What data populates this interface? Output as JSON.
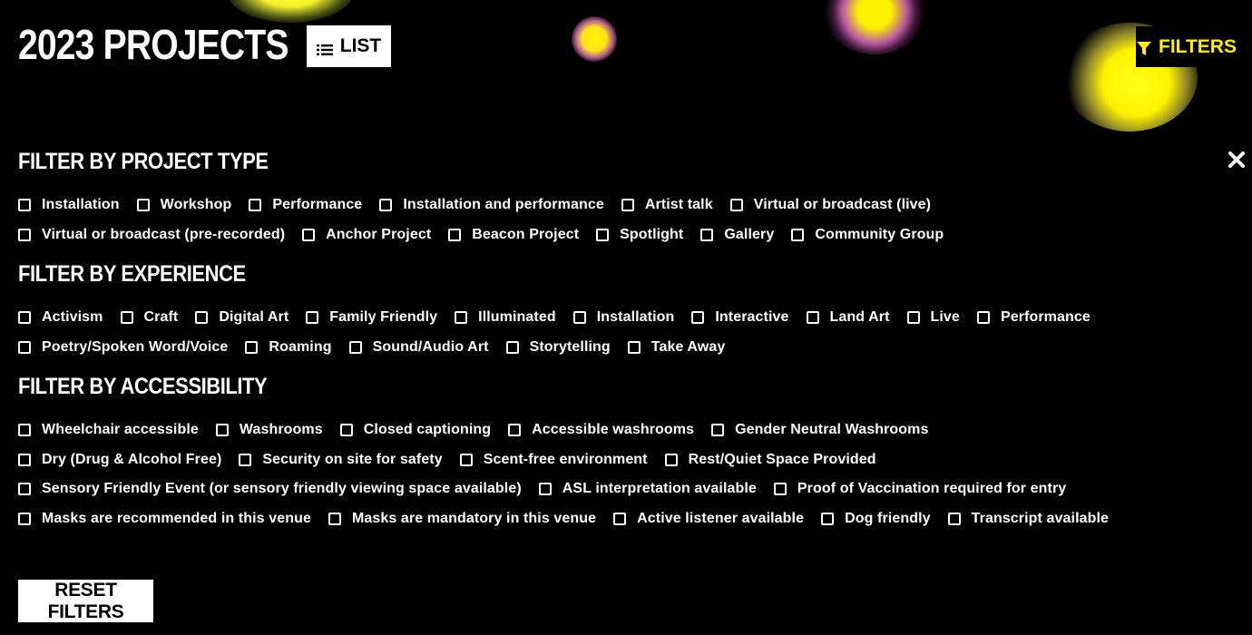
{
  "header": {
    "title": "2023 PROJECTS",
    "list_label": "LIST",
    "filters_label": "FILTERS"
  },
  "colors": {
    "background": "#000000",
    "accent": "#ffee00",
    "text": "#ffffff"
  },
  "icons": {
    "list": "list-icon",
    "filters": "funnel-icon",
    "close": "close-icon"
  },
  "filters": {
    "project_type": {
      "heading": "FILTER BY PROJECT TYPE",
      "rows": [
        [
          "Installation",
          "Workshop",
          "Performance",
          "Installation and performance",
          "Artist talk",
          "Virtual or broadcast (live)"
        ],
        [
          "Virtual or broadcast (pre-recorded)",
          "Anchor Project",
          "Beacon Project",
          "Spotlight",
          "Gallery",
          "Community Group"
        ]
      ]
    },
    "experience": {
      "heading": "FILTER BY EXPERIENCE",
      "rows": [
        [
          "Activism",
          "Craft",
          "Digital Art",
          "Family Friendly",
          "Illuminated",
          "Installation",
          "Interactive",
          "Land Art",
          "Live",
          "Performance"
        ],
        [
          "Poetry/Spoken Word/Voice",
          "Roaming",
          "Sound/Audio Art",
          "Storytelling",
          "Take Away"
        ]
      ]
    },
    "accessibility": {
      "heading": "FILTER BY ACCESSIBILITY",
      "rows": [
        [
          "Wheelchair accessible",
          "Washrooms",
          "Closed captioning",
          "Accessible washrooms",
          "Gender Neutral Washrooms"
        ],
        [
          "Dry (Drug & Alcohol Free)",
          "Security on site for safety",
          "Scent-free environment",
          "Rest/Quiet Space Provided"
        ],
        [
          "Sensory Friendly Event (or sensory friendly viewing space available)",
          "ASL interpretation available",
          "Proof of Vaccination required for entry"
        ],
        [
          "Masks are recommended in this venue",
          "Masks are mandatory in this venue",
          "Active listener available",
          "Dog friendly",
          "Transcript available"
        ]
      ]
    }
  },
  "reset_label": "RESET FILTERS"
}
